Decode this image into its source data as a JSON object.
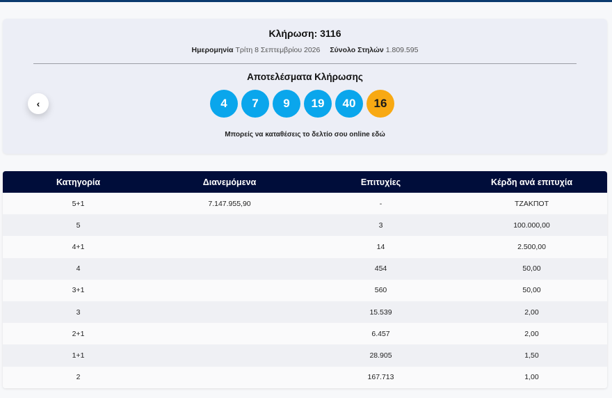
{
  "draw": {
    "title": "Κλήρωση: 3116",
    "date_label": "Ημερομηνία",
    "date_value": "Τρίτη 8 Σεπτεμβρίου 2026",
    "columns_label": "Σύνολο Στηλών",
    "columns_value": "1.809.595",
    "results_title": "Αποτελέσματα Κλήρωσης",
    "prev_label": "‹",
    "numbers": [
      "4",
      "7",
      "9",
      "19",
      "40"
    ],
    "bonus": "16",
    "online_text": "Μπορείς να καταθέσεις το δελτίο σου online εδώ",
    "ball_color": "#0aa6ec",
    "bonus_color": "#f8a913"
  },
  "table": {
    "headers": [
      "Κατηγορία",
      "Διανεμόμενα",
      "Επιτυχίες",
      "Κέρδη ανά επιτυχία"
    ],
    "rows": [
      [
        "5+1",
        "7.147.955,90",
        "-",
        "ΤΖΑΚΠΟΤ"
      ],
      [
        "5",
        "",
        "3",
        "100.000,00"
      ],
      [
        "4+1",
        "",
        "14",
        "2.500,00"
      ],
      [
        "4",
        "",
        "454",
        "50,00"
      ],
      [
        "3+1",
        "",
        "560",
        "50,00"
      ],
      [
        "3",
        "",
        "15.539",
        "2,00"
      ],
      [
        "2+1",
        "",
        "6.457",
        "2,00"
      ],
      [
        "1+1",
        "",
        "28.905",
        "1,50"
      ],
      [
        "2",
        "",
        "167.713",
        "1,00"
      ]
    ]
  }
}
